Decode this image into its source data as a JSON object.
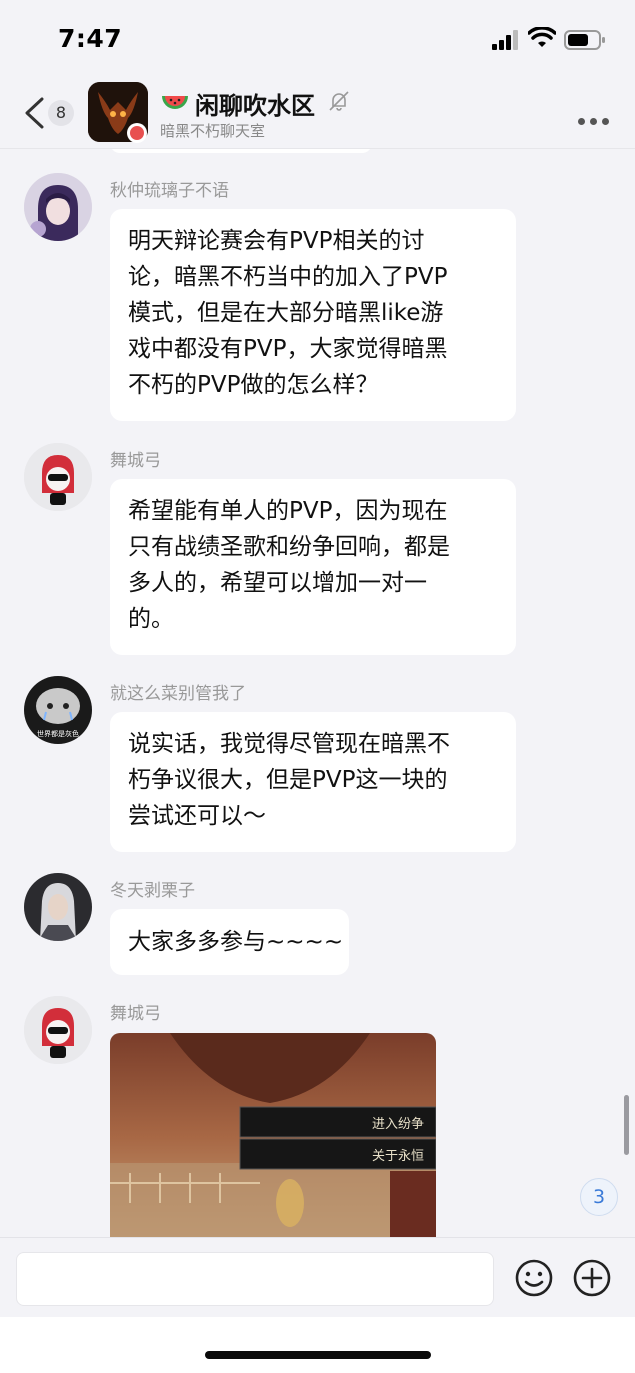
{
  "status_bar": {
    "time": "7:47"
  },
  "header": {
    "back_count": "8",
    "title": "闲聊吹水区",
    "subtitle": "暗黑不朽聊天室",
    "title_emoji": "watermelon-icon"
  },
  "messages": [
    {
      "sender": "秋仲琉璃子不语",
      "lines": [
        "明天辩论赛会有PVP相关的讨",
        "论，暗黑不朽当中的加入了PVP",
        "模式，但是在大部分暗黑like游",
        "戏中都没有PVP，大家觉得暗黑",
        "不朽的PVP做的怎么样？"
      ]
    },
    {
      "sender": "舞城弓",
      "lines": [
        "希望能有单人的PVP，因为现在",
        "只有战绩圣歌和纷争回响，都是",
        "多人的，希望可以增加一对一",
        "的。"
      ]
    },
    {
      "sender": "就这么菜别管我了",
      "avatar_caption": "世界都是灰色",
      "lines": [
        "说实话，我觉得尽管现在暗黑不",
        "朽争议很大，但是PVP这一块的",
        "尝试还可以～"
      ]
    },
    {
      "sender": "冬天剥栗子",
      "lines": [
        "大家多多参与~~~~"
      ]
    },
    {
      "sender": "舞城弓",
      "image_menu": [
        "进入纷争",
        "关于永恒"
      ]
    }
  ],
  "unread_badge": "3",
  "colors": {
    "accent": "#3a7ad8",
    "bubble": "#ffffff",
    "background": "#f3f3f7"
  }
}
